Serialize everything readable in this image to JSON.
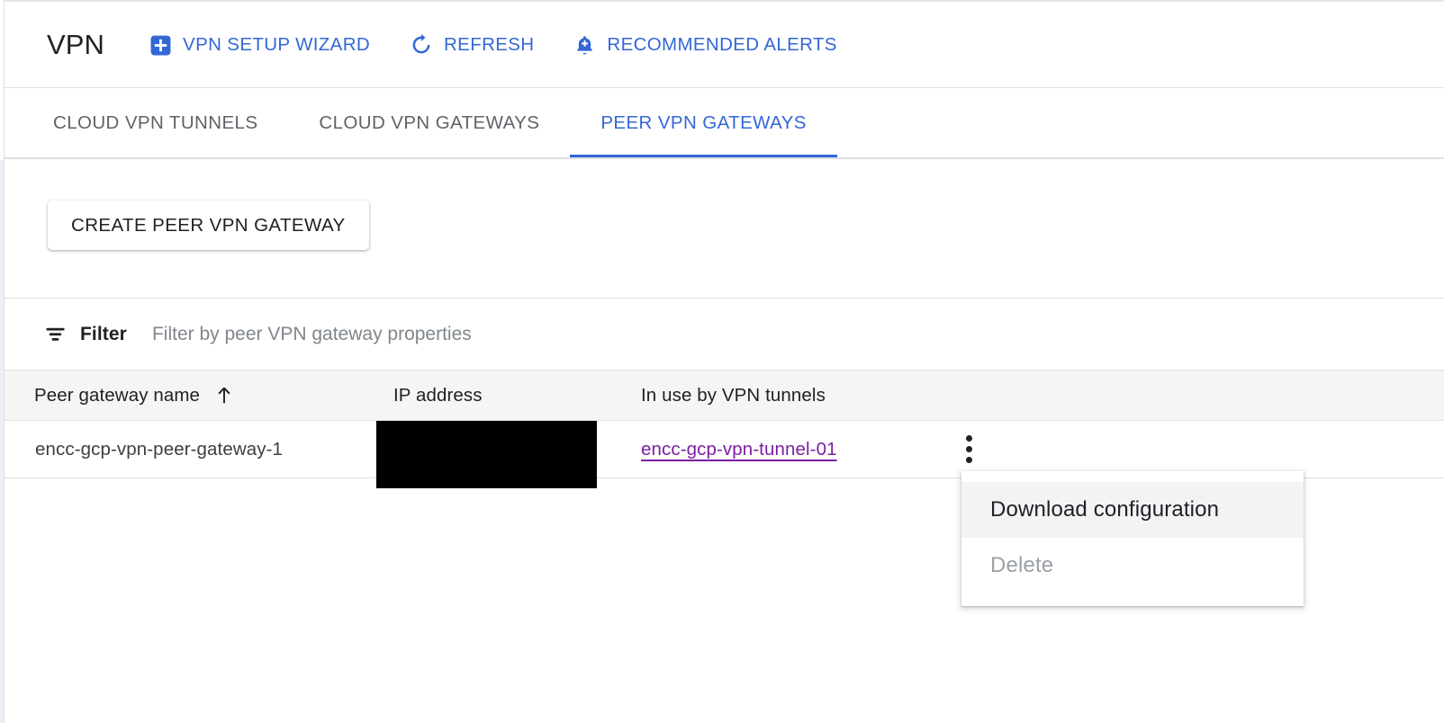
{
  "header": {
    "title": "VPN",
    "actions": [
      {
        "label": "VPN SETUP WIZARD",
        "icon": "plus-box-icon"
      },
      {
        "label": "REFRESH",
        "icon": "refresh-icon"
      },
      {
        "label": "RECOMMENDED ALERTS",
        "icon": "bell-plus-icon"
      }
    ]
  },
  "tabs": [
    {
      "label": "CLOUD VPN TUNNELS",
      "active": false
    },
    {
      "label": "CLOUD VPN GATEWAYS",
      "active": false
    },
    {
      "label": "PEER VPN GATEWAYS",
      "active": true
    }
  ],
  "actionbar": {
    "create_label": "CREATE PEER VPN GATEWAY"
  },
  "filter": {
    "label": "Filter",
    "placeholder": "Filter by peer VPN gateway properties",
    "value": "",
    "icon": "filter-icon"
  },
  "table": {
    "columns": [
      {
        "label": "Peer gateway name",
        "sort": "ascending",
        "sort_icon": "arrow-up-icon"
      },
      {
        "label": "IP address"
      },
      {
        "label": "In use by VPN tunnels"
      }
    ],
    "rows": [
      {
        "peer_gateway_name": "encc-gcp-vpn-peer-gateway-1",
        "ip_address": "",
        "ip_address_redacted": true,
        "in_use_by_vpn_tunnels": "encc-gcp-vpn-tunnel-01",
        "row_menu_icon": "more-vert-icon"
      }
    ]
  },
  "row_menu": {
    "items": [
      {
        "label": "Download configuration",
        "disabled": false,
        "hovered": true
      },
      {
        "label": "Delete",
        "disabled": true,
        "hovered": false
      }
    ]
  },
  "colors": {
    "accent_blue": "#3367d6",
    "link_purple": "#7b1fa2",
    "text_primary": "#202124",
    "text_secondary": "#5f6368",
    "divider": "#e0e0e0",
    "header_row_bg": "#f5f5f5",
    "menu_hover_bg": "#f1f3f4",
    "redaction": "#000000"
  }
}
